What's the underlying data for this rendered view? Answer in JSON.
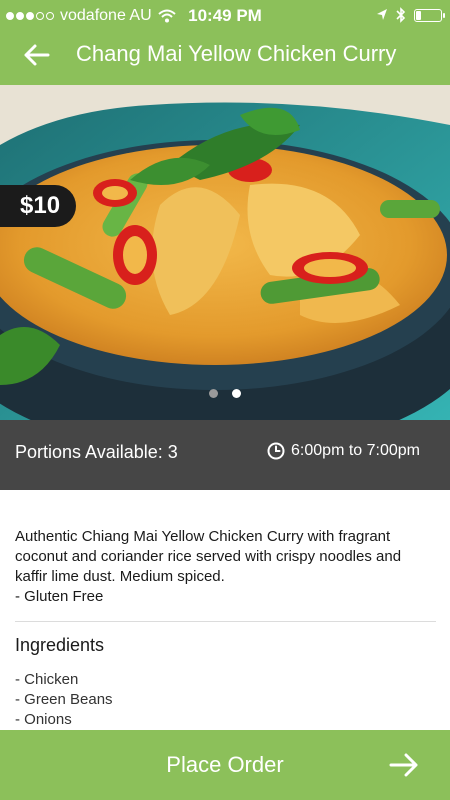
{
  "status_bar": {
    "carrier": "vodafone AU",
    "time": "10:49 PM"
  },
  "nav": {
    "title": "Chang Mai Yellow Chicken Curry",
    "back_icon": "arrow-left-icon"
  },
  "hero": {
    "price": "$10",
    "pager": {
      "count": 2,
      "active_index": 1
    }
  },
  "info": {
    "portions": "Portions Available: 3",
    "time_range": "6:00pm to 7:00pm",
    "clock_icon": "clock-icon"
  },
  "details": {
    "description": "Authentic Chiang Mai Yellow Chicken Curry with fragrant coconut and coriander rice served with crispy noodles and kaffir lime dust. Medium spiced.",
    "dietary": "- Gluten Free",
    "ingredients_title": "Ingredients",
    "ingredients": [
      "- Chicken",
      "- Green Beans",
      "- Onions"
    ]
  },
  "order": {
    "label": "Place Order",
    "arrow_icon": "arrow-right-icon"
  },
  "colors": {
    "accent": "#8cc05a",
    "info_bar": "#464646",
    "price_badge": "#1b1b1b"
  }
}
